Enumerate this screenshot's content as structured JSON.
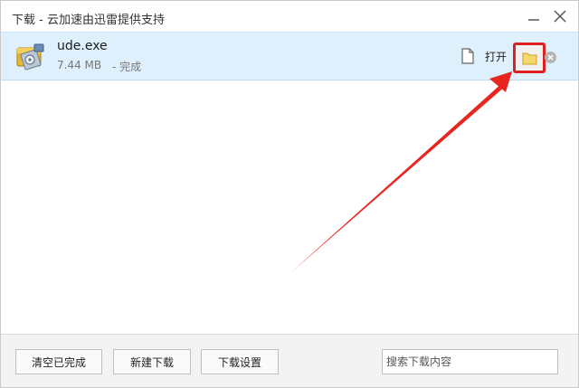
{
  "window": {
    "title": "下载 - 云加速由迅雷提供支持"
  },
  "download_item": {
    "file_name": "ude.exe",
    "file_size": "7.44 MB",
    "status": "- 完成",
    "open_label": "打开"
  },
  "footer": {
    "clear_completed_label": "清空已完成",
    "new_download_label": "新建下载",
    "download_settings_label": "下载设置",
    "search_placeholder": "搜索下载内容"
  },
  "colors": {
    "highlight_border": "#e02020",
    "arrow": "#e8261f",
    "item_background": "#def0fb",
    "folder_icon": "#f5d76e"
  },
  "icons": {
    "file": "installer-file-icon",
    "doc": "document-icon",
    "folder": "folder-icon",
    "delete": "delete-circle-icon",
    "minimize": "minimize-icon",
    "close": "close-icon"
  }
}
